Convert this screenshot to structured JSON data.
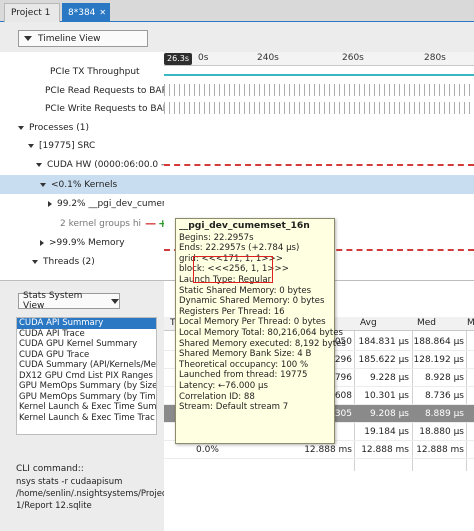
{
  "tabs": [
    {
      "label": "Project 1"
    },
    {
      "label": "8*384"
    }
  ],
  "timeline_view": {
    "label": "Timeline View"
  },
  "ruler": {
    "cursor": "26.3s",
    "ticks": [
      "0s",
      "240s",
      "260s",
      "280s"
    ]
  },
  "tree": [
    {
      "label": "PCIe TX Throughput"
    },
    {
      "label": "PCIe Read Requests to BAR1"
    },
    {
      "label": "PCIe Write Requests to BAR1"
    },
    {
      "label": "Processes (1)"
    },
    {
      "label": "[19775] SRC"
    },
    {
      "label": "CUDA HW (0000:06:00.0 - NVI"
    },
    {
      "label": "<0.1% Kernels"
    },
    {
      "label": "99.2% __pgi_dev_cumen"
    },
    {
      "label": "2 kernel groups hi"
    },
    {
      "label": ">99.9% Memory"
    },
    {
      "label": "Threads (2)"
    }
  ],
  "stats_view": {
    "label": "Stats System View"
  },
  "reports": [
    "CUDA API Summary",
    "CUDA API Trace",
    "CUDA GPU Kernel Summary",
    "CUDA GPU Trace",
    "CUDA Summary (API/Kernels/Mer",
    "DX12 GPU Cmd List PIX Ranges Su",
    "GPU MemOps Summary (by Size)",
    "GPU MemOps Summary (by Time",
    "Kernel Launch & Exec Time Summ",
    "Kernel Launch & Exec Time Trac"
  ],
  "cli": {
    "label": "CLI command::",
    "text": "nsys stats -r cudaapisum /home/senlin/.nsightsystems/Projects/Project 1/Report 12.sqlite"
  },
  "table": {
    "headers": [
      "T",
      "Avg",
      "Med",
      "M"
    ],
    "rows": [
      {
        "c1": "1050",
        "avg": "184.831 µs",
        "med": "188.864 µs",
        "dark": false
      },
      {
        "c1": "296",
        "avg": "185.622 µs",
        "med": "128.192 µs",
        "dark": false
      },
      {
        "c1": "2796",
        "avg": "9.228 µs",
        "med": "8.928 µs",
        "dark": false
      },
      {
        "c1": "608",
        "avg": "10.301 µs",
        "med": "8.736 µs",
        "dark": false
      },
      {
        "c1": "7305",
        "avg": "9.208 µs",
        "med": "8.889 µs",
        "dark": true
      },
      {
        "c1": "",
        "avg": "19.184 µs",
        "med": "18.880 µs",
        "dark": false
      },
      {
        "c1": "12.888 ms",
        "avg": "12.888 ms",
        "med": "12.888 ms",
        "dark": false,
        "pct": "0.0%"
      }
    ]
  },
  "tooltip": {
    "title": "__pgi_dev_cumemset_16n",
    "lines": [
      "Begins: 22.2957s",
      "Ends: 22.2957s (+2.784 µs)",
      "grid: <<<171, 1, 1>>>",
      "block: <<<256, 1, 1>>>",
      "Launch Type: Regular",
      "Static Shared Memory: 0 bytes",
      "Dynamic Shared Memory: 0 bytes",
      "Registers Per Thread: 16",
      "Local Memory Per Thread: 0 bytes",
      "Local Memory Total: 80,216,064 bytes",
      "Shared Memory executed: 8,192 bytes",
      "Shared Memory Bank Size: 4 B",
      "Theoretical occupancy: 100 %",
      "Launched from thread: 19775",
      "Latency: ←76.000 µs",
      "Correlation ID: 88",
      "Stream: Default stream 7"
    ]
  }
}
